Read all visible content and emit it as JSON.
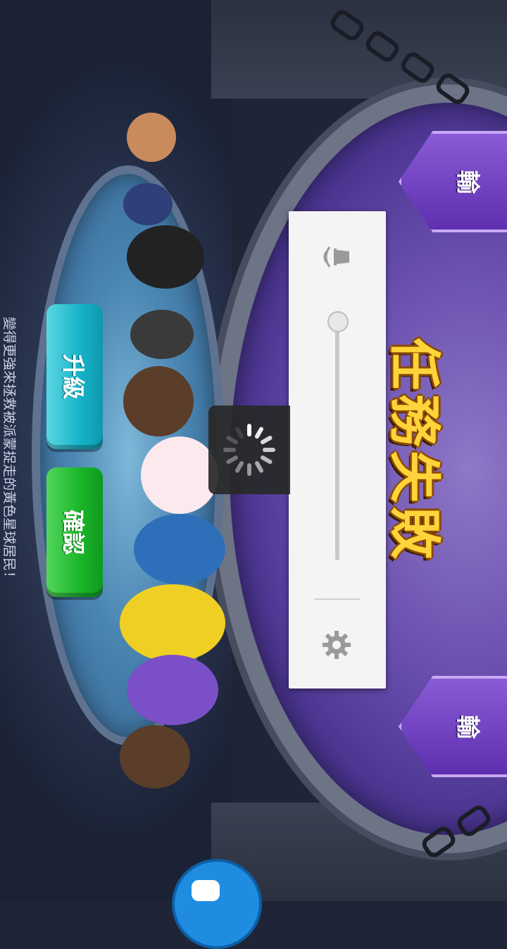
{
  "title": "任務失敗",
  "badges": {
    "top_label": "輸",
    "bottom_label": "輸"
  },
  "buttons": {
    "upgrade_label": "升級",
    "confirm_label": "確認"
  },
  "hint_text": "變得更強來拯救被派蒙捉走的黃色星球居民！",
  "volume": {
    "level": 0.0
  },
  "colors": {
    "title_fill": "#ffd43a",
    "upgrade_button": "#16b3c8",
    "confirm_button": "#1bb52a",
    "badge": "#6a3cc0"
  },
  "icons": {
    "volume": "bell-icon",
    "settings": "gear-icon",
    "loading": "spinner-icon",
    "floating": "assistant-icon"
  }
}
